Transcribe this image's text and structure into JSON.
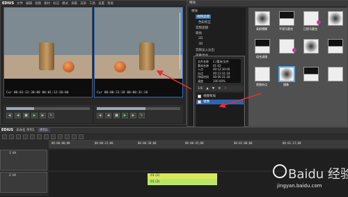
{
  "app": {
    "logo": "EDIUS",
    "menu": [
      "文件",
      "编辑",
      "视图",
      "素材",
      "标记",
      "模式",
      "采集",
      "渲染",
      "工具",
      "设置",
      "帮助"
    ]
  },
  "player": {
    "source_timecode": "Cur 00:01:12:30:00   00:01:12:30:00",
    "record_timecode": "Cur 00:00:31:18   00:00:31:18"
  },
  "effects": {
    "panel_title": "特效",
    "tree": [
      {
        "label": "特效",
        "selected": false
      },
      {
        "label": "视频滤镜",
        "selected": true
      },
      {
        "label": "色彩校正",
        "selected": false
      },
      {
        "label": "音频滤镜",
        "selected": false
      },
      {
        "label": "转场",
        "selected": false
      },
      {
        "label": "2D",
        "selected": false
      },
      {
        "label": "3D",
        "selected": false
      },
      {
        "label": "音频淡入淡出",
        "selected": false
      },
      {
        "label": "字幕混合",
        "selected": false
      },
      {
        "label": "键",
        "selected": false
      }
    ],
    "tiles": [
      {
        "label": "高斯模糊",
        "marked": false,
        "selected": false
      },
      {
        "label": "平滑马赛克",
        "marked": false,
        "selected": false
      },
      {
        "label": "已经马赛克",
        "marked": true,
        "selected": false
      },
      {
        "label": "",
        "marked": false,
        "selected": false
      },
      {
        "label": "组合滤镜",
        "marked": false,
        "selected": false
      },
      {
        "label": "",
        "marked": true,
        "selected": false
      },
      {
        "label": "",
        "marked": false,
        "selected": false
      },
      {
        "label": "",
        "marked": false,
        "selected": false
      },
      {
        "label": "视频杂点",
        "marked": false,
        "selected": false
      },
      {
        "label": "镜像",
        "marked": false,
        "selected": true
      },
      {
        "label": "",
        "marked": false,
        "selected": false
      },
      {
        "label": "",
        "marked": false,
        "selected": false
      }
    ]
  },
  "info": {
    "rows": [
      {
        "k": "文件名称",
        "v": "C:/素材/文件"
      },
      {
        "k": "素材名称",
        "v": "01-02"
      },
      {
        "k": "入点",
        "v": "00:12:30:00"
      },
      {
        "k": "出点",
        "v": "00:12:31:18"
      },
      {
        "k": "持续时间",
        "v": "00:00:31:18"
      },
      {
        "k": "速度",
        "v": "100.00%"
      }
    ],
    "toolbar_page": "1/6",
    "filters": [
      {
        "label": "视频布局",
        "selected": false
      },
      {
        "label": "镜像",
        "selected": true
      }
    ]
  },
  "timeline": {
    "project": "未命名 序列1",
    "sequence": "序列1",
    "ruler": [
      "00:00:00;00",
      "00:00:15;00",
      "00:00:30;00",
      "00:00:45;00",
      "00:01:00;00",
      "00:01:15;00"
    ],
    "tracks": [
      {
        "name": "1 VA"
      },
      {
        "name": "2 VA"
      }
    ],
    "clip_v": "01 (2)",
    "clip_a": "01 (2)"
  },
  "watermark": {
    "text": "Baidu 经验",
    "url": "jingyan.baidu.com"
  },
  "colors": {
    "annotation_arrow": "#e03030",
    "selection": "#3a6ea5",
    "clip": "#d8e85a"
  }
}
